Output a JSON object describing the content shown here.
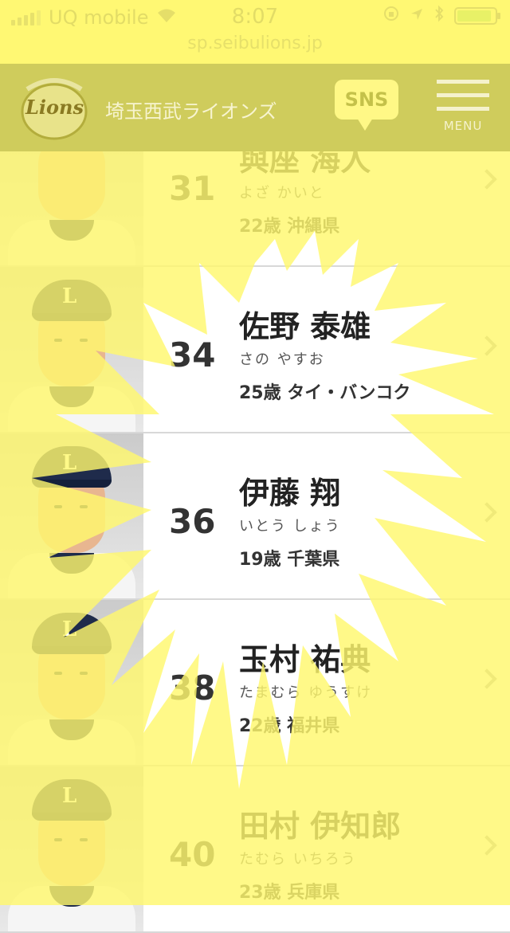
{
  "status": {
    "carrier": "UQ mobile",
    "time": "8:07",
    "icons": [
      "signal-icon",
      "wifi-icon",
      "rotation-lock-icon",
      "location-icon",
      "bluetooth-icon",
      "battery-icon"
    ]
  },
  "browser": {
    "url": "sp.seibulions.jp"
  },
  "header": {
    "logo_text": "Lions",
    "team_name": "埼玉西武ライオンズ",
    "sns_label": "SNS",
    "menu_label": "MENU"
  },
  "players": [
    {
      "number": "31",
      "name": "與座 海人",
      "kana": "よざ かいと",
      "info": "22歳 沖縄県"
    },
    {
      "number": "34",
      "name": "佐野 泰雄",
      "kana": "さの やすお",
      "info": "25歳 タイ・バンコク"
    },
    {
      "number": "36",
      "name": "伊藤 翔",
      "kana": "いとう しょう",
      "info": "19歳 千葉県"
    },
    {
      "number": "38",
      "name": "玉村 祐典",
      "kana": "たまむら ゆうすけ",
      "info": "22歳 福井県"
    },
    {
      "number": "40",
      "name": "田村 伊知郎",
      "kana": "たむら いちろう",
      "info": "23歳 兵庫県"
    }
  ],
  "colors": {
    "overlay_yellow": "#fff86e",
    "header_olive": "#cfcc5c",
    "cap_navy": "#1f2b4b"
  }
}
